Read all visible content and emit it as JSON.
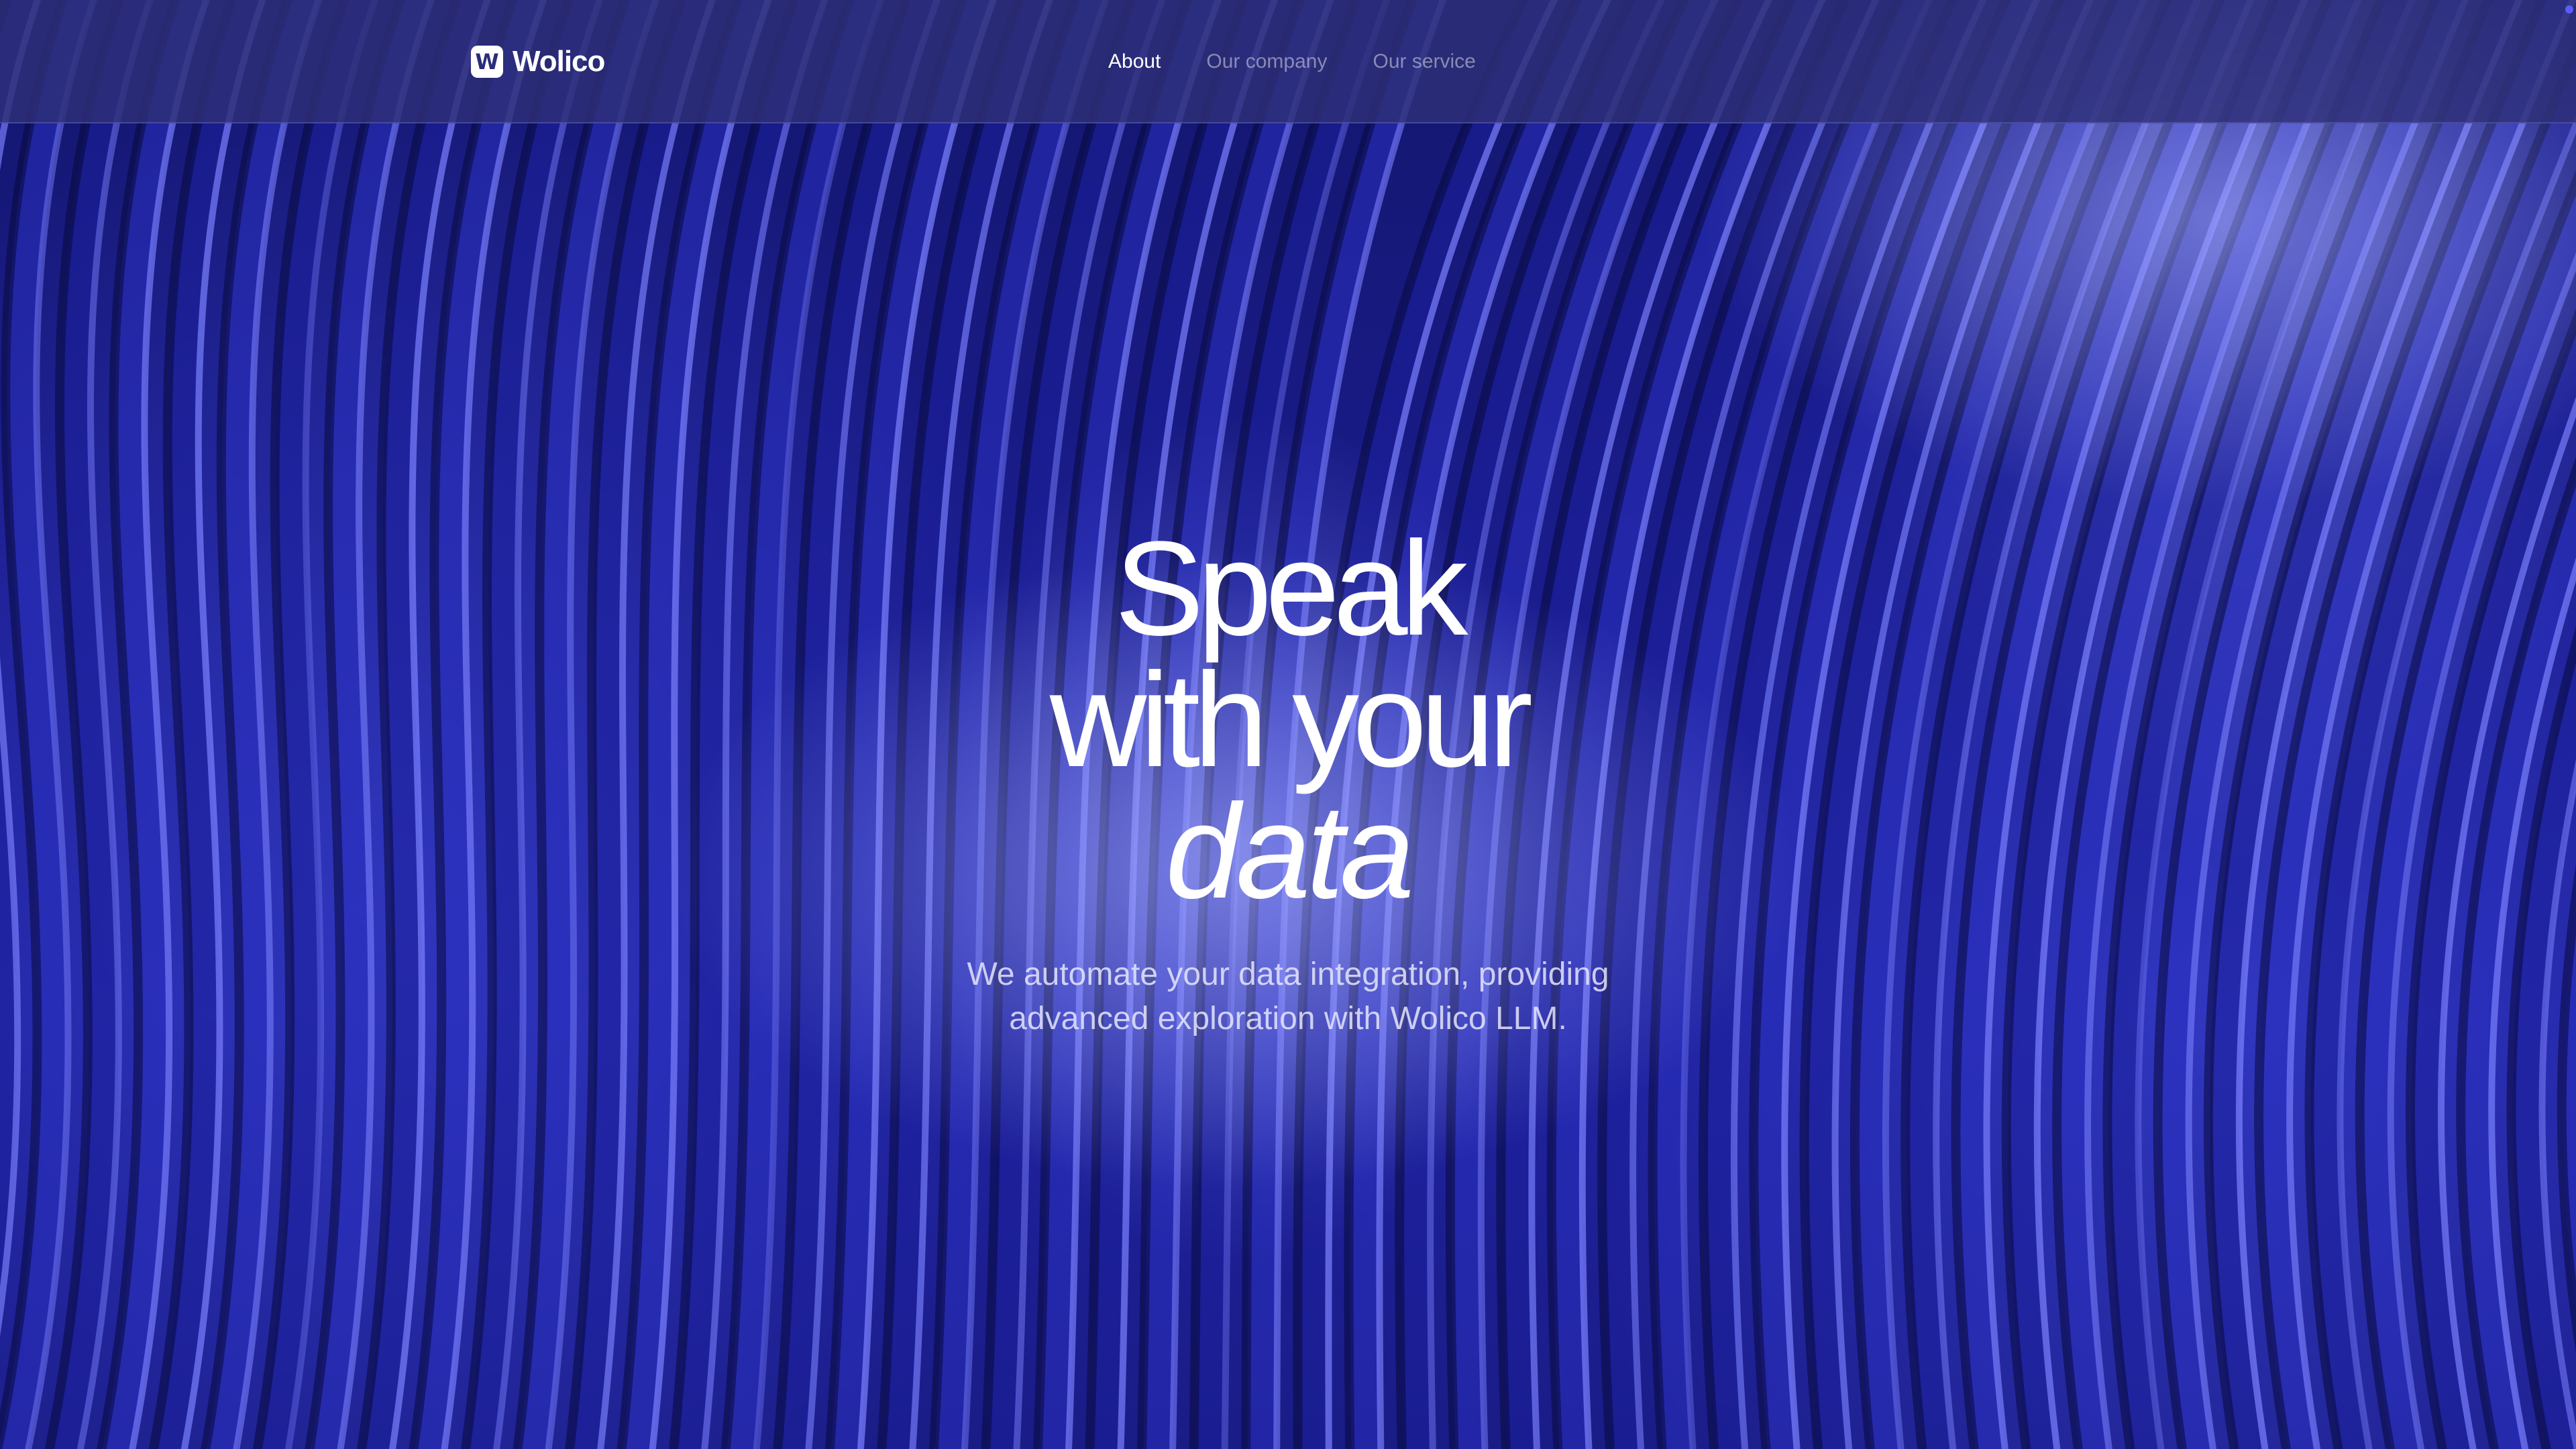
{
  "brand": {
    "logo_glyph": "W",
    "name": "Wolico"
  },
  "nav": {
    "items": [
      {
        "label": "About",
        "active": true
      },
      {
        "label": "Our company",
        "active": false
      },
      {
        "label": "Our service",
        "active": false
      }
    ]
  },
  "hero": {
    "headline_line1": "Speak",
    "headline_line2": "with your",
    "headline_accent": "data",
    "subtitle": "We automate your data integration, providing advanced exploration with Wolico LLM."
  },
  "colors": {
    "background_deep": "#14166e",
    "wave_highlight": "#7c82ff",
    "navbar": "#2e3078",
    "text": "#ffffff"
  }
}
